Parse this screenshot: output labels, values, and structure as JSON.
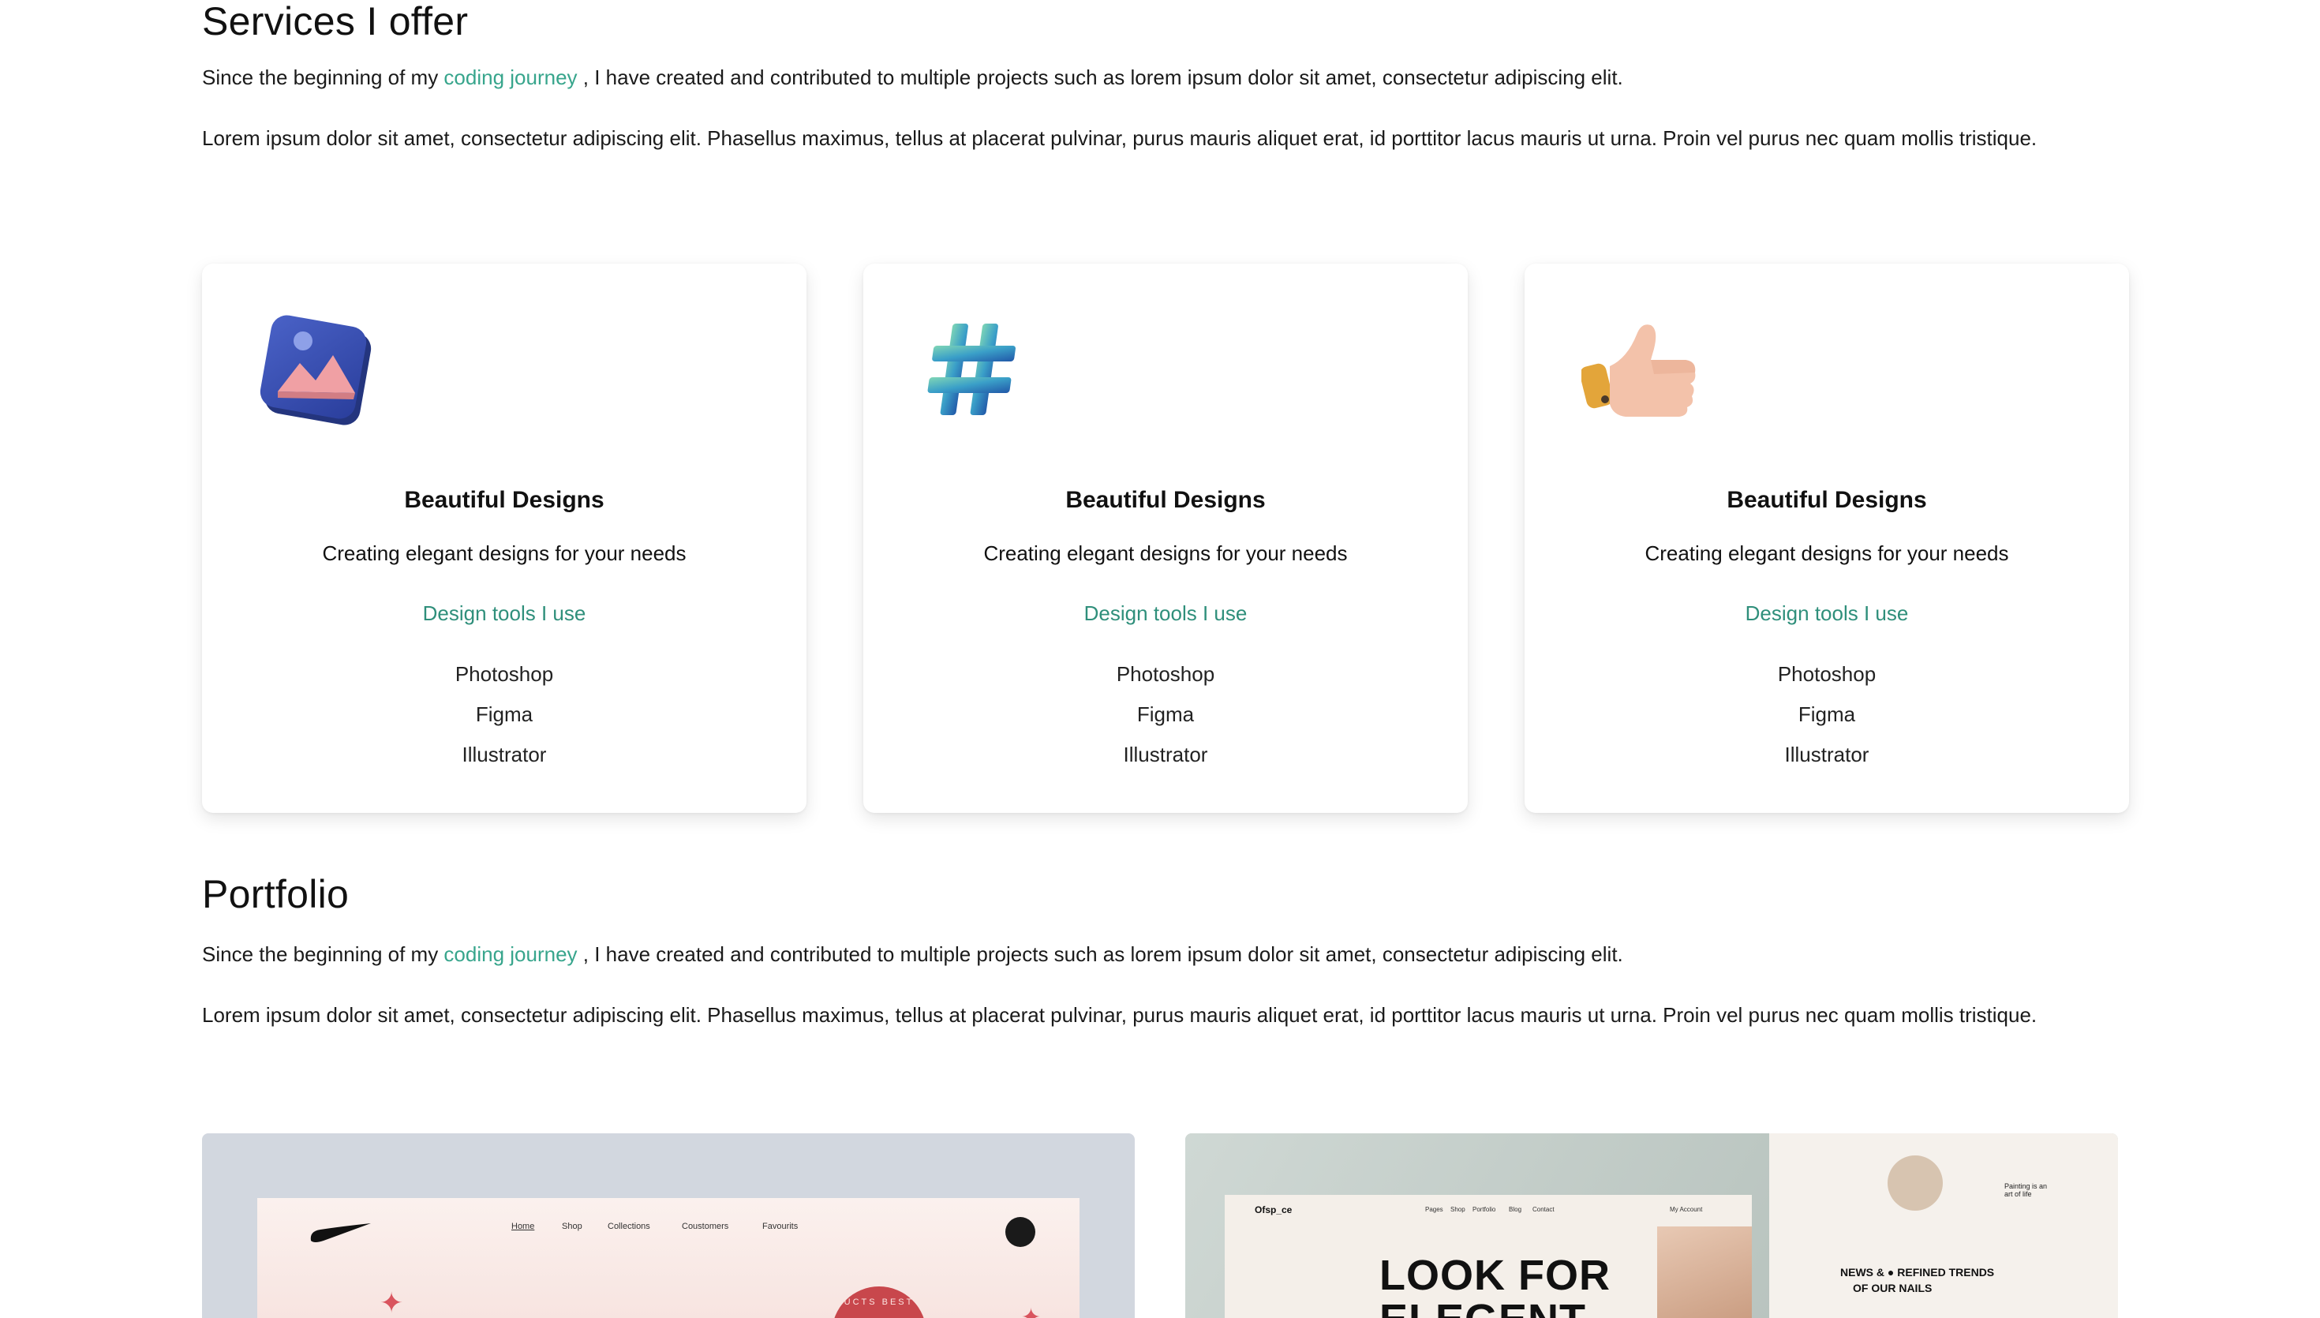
{
  "services": {
    "title": "Services I offer",
    "intro_before": "Since the beginning of my ",
    "intro_link": "coding journey",
    "intro_after": " , I have created and contributed to multiple projects such as lorem ipsum dolor sit amet, consectetur adipiscing elit.",
    "lorem": "Lorem ipsum dolor sit amet, consectetur adipiscing elit. Phasellus maximus, tellus at placerat pulvinar, purus mauris aliquet erat, id porttitor lacus mauris ut urna. Proin vel purus nec quam mollis tristique.",
    "cards": [
      {
        "icon": "image-icon",
        "title": "Beautiful Designs",
        "subtitle": "Creating elegant designs for your needs",
        "tools_heading": "Design tools I use",
        "tools": [
          "Photoshop",
          "Figma",
          "Illustrator"
        ]
      },
      {
        "icon": "hashtag-icon",
        "title": "Beautiful Designs",
        "subtitle": "Creating elegant designs for your needs",
        "tools_heading": "Design tools I use",
        "tools": [
          "Photoshop",
          "Figma",
          "Illustrator"
        ]
      },
      {
        "icon": "thumbs-up-icon",
        "title": "Beautiful Designs",
        "subtitle": "Creating elegant designs for your needs",
        "tools_heading": "Design tools I use",
        "tools": [
          "Photoshop",
          "Figma",
          "Illustrator"
        ]
      }
    ]
  },
  "portfolio": {
    "title": "Portfolio",
    "intro_before": "Since the beginning of my ",
    "intro_link": "coding journey",
    "intro_after": " , I have created and contributed to multiple projects such as lorem ipsum dolor sit amet, consectetur adipiscing elit.",
    "lorem": "Lorem ipsum dolor sit amet, consectetur adipiscing elit. Phasellus maximus, tellus at placerat pulvinar, purus mauris aliquet erat, id porttitor lacus mauris ut urna. Proin vel purus nec quam mollis tristique.",
    "projects": [
      {
        "nav": [
          "Home",
          "Shop",
          "Collections",
          "Coustomers",
          "Favourits"
        ],
        "badge": "UCTS BEST"
      },
      {
        "brand": "Ofsp_ce",
        "nav": [
          "Pages",
          "Shop",
          "Portfolio",
          "Blog",
          "Contact"
        ],
        "account": "My Account",
        "headline_1": "LOOK FOR",
        "headline_2": "ELEGENT",
        "news": "NEWS &",
        "news_2": "REFINED TRENDS",
        "news_3": "OF OUR NAILS",
        "side_caption": "Painting is an art of life"
      }
    ]
  },
  "colors": {
    "accent": "#37a58c",
    "tools_heading": "#2f8f7b"
  }
}
